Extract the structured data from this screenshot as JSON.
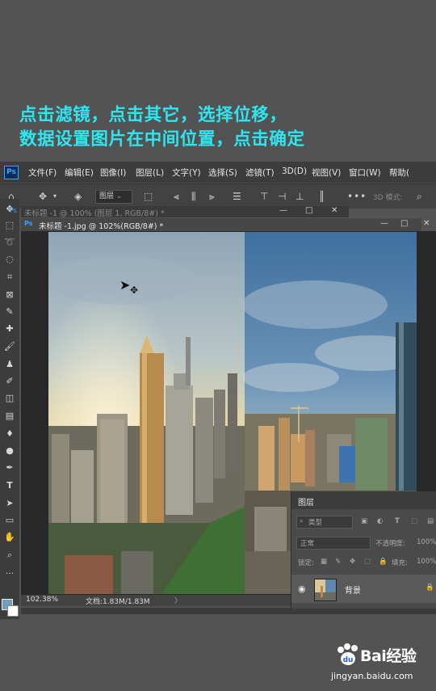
{
  "caption": {
    "line1": "点击滤镜，点击其它，选择位移，",
    "line2": "数据设置图片在中间位置，点击确定"
  },
  "app": {
    "logo": "Ps",
    "menus": [
      "文件(F)",
      "编辑(E)",
      "图像(I)",
      "图层(L)",
      "文字(Y)",
      "选择(S)",
      "滤镜(T)",
      "3D(D)",
      "视图(V)",
      "窗口(W)",
      "帮助("
    ]
  },
  "options_bar": {
    "layer_select": "图层",
    "mode_3d": "3D 模式:"
  },
  "documents": {
    "tab_background": "未标题 -1 @ 100% (图层 1, RGB/8#) *",
    "tab_active": "未标题 -1.jpg @ 102%(RGB/8#) *"
  },
  "status": {
    "zoom": "102.38%",
    "doc": "文档:1.83M/1.83M"
  },
  "layers_panel": {
    "title": "图层",
    "filter_label": "类型",
    "blend_mode": "正常",
    "opacity_label": "不透明度:",
    "opacity_value": "100%",
    "lock_label": "锁定:",
    "fill_label": "填充:",
    "fill_value": "100%",
    "layer_name": "背景"
  },
  "watermark": {
    "brand": "Bai经验",
    "url": "jingyan.baidu.com"
  },
  "colors": {
    "caption": "#2ee6f0",
    "accent": "#31a8ff"
  }
}
